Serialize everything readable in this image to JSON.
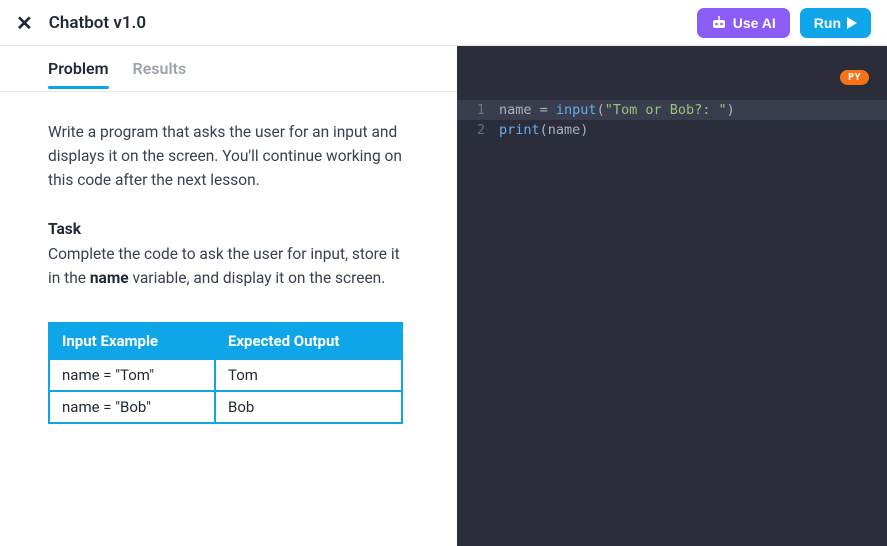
{
  "header": {
    "title": "Chatbot v1.0",
    "use_ai_label": "Use AI",
    "run_label": "Run"
  },
  "tabs": {
    "problem": "Problem",
    "results": "Results"
  },
  "problem": {
    "description": "Write a program that asks the user for an input and displays it on the screen. You'll continue working on this code after the next lesson.",
    "task_heading": "Task",
    "task_pre": "Complete the code to ask the user for input, store it in the ",
    "task_var": "name",
    "task_post": " variable, and display it on the screen.",
    "table": {
      "headers": [
        "Input Example",
        "Expected Output"
      ],
      "rows": [
        {
          "input": "name = \"Tom\"",
          "output": "Tom"
        },
        {
          "input": "name = \"Bob\"",
          "output": "Bob"
        }
      ]
    }
  },
  "editor": {
    "language_badge": "PY",
    "lines": [
      {
        "n": "1",
        "tokens": [
          {
            "t": "name ",
            "c": "var"
          },
          {
            "t": "=",
            "c": "op"
          },
          {
            "t": " ",
            "c": "var"
          },
          {
            "t": "input",
            "c": "fn"
          },
          {
            "t": "(",
            "c": "pn"
          },
          {
            "t": "\"Tom or Bob?: \"",
            "c": "str"
          },
          {
            "t": ")",
            "c": "pn"
          }
        ],
        "hl": true
      },
      {
        "n": "2",
        "tokens": [
          {
            "t": "print",
            "c": "fn"
          },
          {
            "t": "(",
            "c": "pn"
          },
          {
            "t": "name",
            "c": "var"
          },
          {
            "t": ")",
            "c": "pn"
          }
        ],
        "hl": false
      }
    ]
  }
}
